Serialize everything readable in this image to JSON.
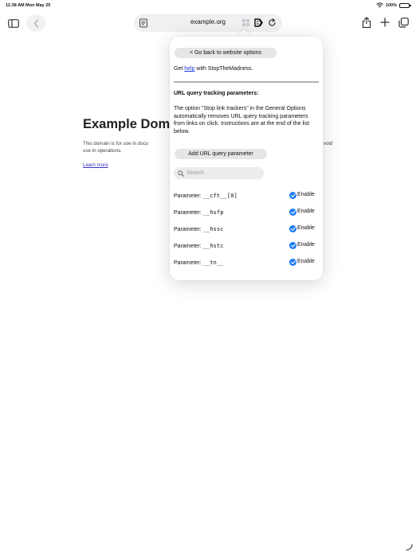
{
  "status_bar": {
    "time_date": "11:38 AM  Mon May 25",
    "battery_percent": "100%",
    "wifi_icon": "wifi-icon",
    "battery_icon": "battery-icon"
  },
  "toolbar": {
    "address": "example.org",
    "icons": [
      "sidebar-icon",
      "back-icon",
      "reader-icon",
      "puzzle-icon",
      "extension-icon",
      "reload-icon",
      "share-icon",
      "plus-icon",
      "tabs-icon"
    ]
  },
  "page": {
    "title": "Example Doma",
    "body_line1": "This domain is for use in docu",
    "body_line2": "use in operations.",
    "body_tail": "void",
    "link": "Learn more"
  },
  "popover": {
    "go_back_label": "< Go back to website options",
    "help_prefix": "Get ",
    "help_link": "help",
    "help_suffix": " with StopTheMadness.",
    "section_title": "URL query tracking parameters:",
    "description": "The option \"Stop link trackers\" in the General Options automatically removes URL query tracking parameters from links on click. Instructions are at the end of the list below.",
    "add_label": "Add URL query parameter",
    "search_placeholder": "Search",
    "param_prefix": "Parameter: ",
    "enable_label": "Enable",
    "parameters": [
      {
        "name": "__cft__[0]",
        "enabled": true
      },
      {
        "name": "__hsfp",
        "enabled": true
      },
      {
        "name": "__hssc",
        "enabled": true
      },
      {
        "name": "__hstc",
        "enabled": true
      },
      {
        "name": "__tn__",
        "enabled": true
      }
    ]
  },
  "colors": {
    "accent": "#1c7cf5",
    "link": "#1a3bd6",
    "page_link": "#3b33c4",
    "pill": "#e6e6e8"
  }
}
